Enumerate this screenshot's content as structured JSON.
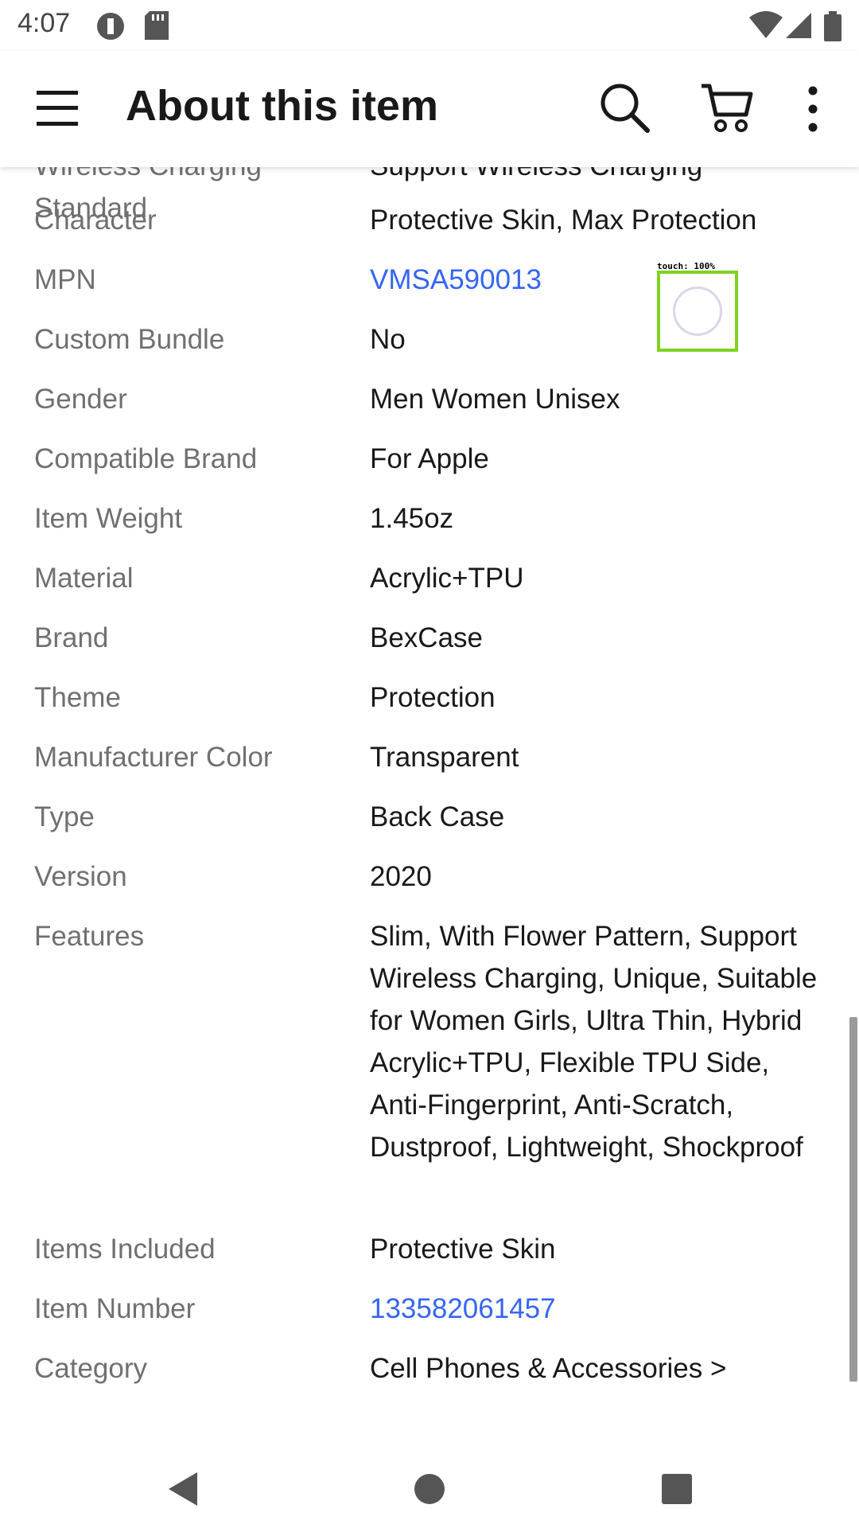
{
  "status_bar": {
    "time": "4:07"
  },
  "app_bar": {
    "title": "About this item",
    "icons": [
      "menu-icon",
      "search-icon",
      "cart-icon",
      "more-vert-icon"
    ]
  },
  "partial_row": {
    "label_tail": "Standard",
    "label_cut": "Wireless Charging",
    "value_cut": "Support Wireless Charging"
  },
  "specs": [
    {
      "label": "Character",
      "value": "Protective Skin, Max Protection"
    },
    {
      "label": "MPN",
      "value": "VMSA590013",
      "link": true
    },
    {
      "label": "Custom Bundle",
      "value": "No"
    },
    {
      "label": "Gender",
      "value": "Men Women Unisex"
    },
    {
      "label": "Compatible Brand",
      "value": "For Apple"
    },
    {
      "label": "Item Weight",
      "value": "1.45oz"
    },
    {
      "label": "Material",
      "value": "Acrylic+TPU"
    },
    {
      "label": "Brand",
      "value": "BexCase"
    },
    {
      "label": "Theme",
      "value": "Protection"
    },
    {
      "label": "Manufacturer Color",
      "value": "Transparent"
    },
    {
      "label": "Type",
      "value": "Back Case"
    },
    {
      "label": "Version",
      "value": "2020"
    },
    {
      "label": "Features",
      "value": "Slim, With Flower Pattern, Support Wireless Charging, Unique, Suitable for Women Girls, Ultra Thin, Hybrid Acrylic+TPU, Flexible TPU Side, Anti-Fingerprint, Anti-Scratch, Dustproof, Lightweight, Shockproof"
    },
    {
      "label": "Items Included",
      "value": "Protective Skin"
    },
    {
      "label": "Item Number",
      "value": "133582061457",
      "link": true
    },
    {
      "label": "Category",
      "value": "Cell Phones & Accessories >"
    }
  ],
  "touch_overlay": {
    "label": "touch: 100%"
  },
  "colors": {
    "link": "#3665f3",
    "label": "#707070",
    "text": "#191919",
    "touch": "#7ed321"
  }
}
